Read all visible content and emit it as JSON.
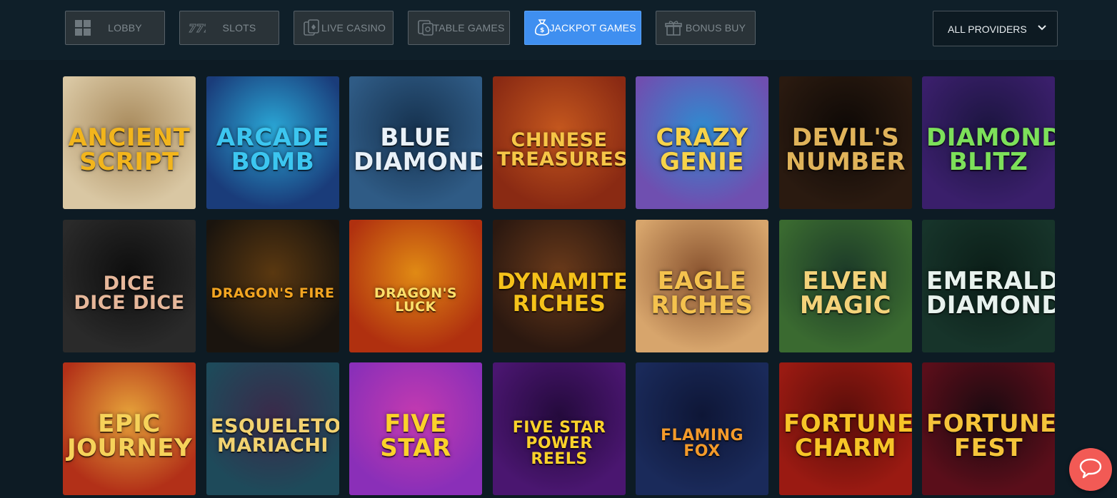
{
  "nav": {
    "tabs": [
      {
        "label": "LOBBY",
        "icon": "grid-icon"
      },
      {
        "label": "SLOTS",
        "icon": "slots-777-icon"
      },
      {
        "label": "LIVE CASINO",
        "icon": "live-casino-cards-icon"
      },
      {
        "label": "TABLE GAMES",
        "icon": "table-games-icon"
      },
      {
        "label": "JACKPOT GAMES",
        "icon": "money-bag-icon",
        "active": true
      },
      {
        "label": "BONUS BUY",
        "icon": "gift-icon"
      }
    ],
    "providers": {
      "label": "ALL PROVIDERS",
      "icon": "chevron-down-icon"
    }
  },
  "games": [
    {
      "name": "ANCIENT SCRIPT",
      "display": "ANCIENT\nSCRIPT",
      "bg": "#d9c7a3",
      "bg2": "#a88a5c",
      "fg": "#f2b51c"
    },
    {
      "name": "ARCADE BOMB",
      "display": "ARCADE\nBOMB",
      "bg": "#1a3c7a",
      "bg2": "#2aa7d6",
      "fg": "#3cc6f0"
    },
    {
      "name": "BLUE DIAMOND",
      "display": "BLUE\nDIAMOND",
      "bg": "#2f5b85",
      "bg2": "#16324f",
      "fg": "#e9f1f8"
    },
    {
      "name": "CHINESE TREASURES",
      "display": "CHINESE\nTREASURES",
      "bg": "#8a2a13",
      "bg2": "#c4571e",
      "fg": "#f6c647"
    },
    {
      "name": "CRAZY GENIE",
      "display": "CRAZY\nGENIE",
      "bg": "#6f4fb0",
      "bg2": "#2f8bd0",
      "fg": "#f7d34a"
    },
    {
      "name": "DEVIL'S NUMBER",
      "display": "DEVIL'S\nNUMBER",
      "bg": "#2a1a10",
      "bg2": "#0e0906",
      "fg": "#e0b35a"
    },
    {
      "name": "DIAMOND BLITZ",
      "display": "DIAMOND\nBLITZ",
      "bg": "#3a1f6b",
      "bg2": "#1c1540",
      "fg": "#7de05a"
    },
    {
      "name": "DICE DICE DICE",
      "display": "DICE\nDICE DICE",
      "bg": "#2a2a2a",
      "bg2": "#0e0e0e",
      "fg": "#e6b79a"
    },
    {
      "name": "DRAGON'S FIRE",
      "display": "DRAGON'S FIRE",
      "bg": "#1a140e",
      "bg2": "#5a3810",
      "fg": "#f3a521"
    },
    {
      "name": "DRAGON'S LUCK",
      "display": "DRAGON'S LUCK",
      "bg": "#b0300f",
      "bg2": "#e08a14",
      "fg": "#fce06a"
    },
    {
      "name": "DYNAMITE RICHES",
      "display": "DYNAMITE\nRICHES",
      "bg": "#2b1810",
      "bg2": "#6a3a1a",
      "fg": "#f5c21a"
    },
    {
      "name": "EAGLE RICHES",
      "display": "EAGLE\nRICHES",
      "bg": "#d7a56c",
      "bg2": "#8a5430",
      "fg": "#f4c24e"
    },
    {
      "name": "ELVEN MAGIC",
      "display": "ELVEN\nMAGIC",
      "bg": "#3a6a30",
      "bg2": "#1c3a28",
      "fg": "#f3d27a"
    },
    {
      "name": "EMERALD DIAMOND",
      "display": "EMERALD\nDIAMOND",
      "bg": "#17342a",
      "bg2": "#0b1e18",
      "fg": "#e8f2ee"
    },
    {
      "name": "EPIC JOURNEY",
      "display": "EPIC\nJOURNEY",
      "bg": "#b23018",
      "bg2": "#e6a33a",
      "fg": "#f6d25a"
    },
    {
      "name": "ESQUELETO MARIACHI",
      "display": "ESQUELETO\nMARIACHI",
      "bg": "#1e4a5a",
      "bg2": "#3a2a4a",
      "fg": "#f2d270"
    },
    {
      "name": "FIVE STAR",
      "display": "FIVE\nSTAR",
      "bg": "#8a2fb8",
      "bg2": "#c43ab0",
      "fg": "#fbd22a"
    },
    {
      "name": "FIVE STAR POWER REELS",
      "display": "FIVE STAR\nPOWER REELS",
      "bg": "#4a1670",
      "bg2": "#240a3c",
      "fg": "#fbd22a"
    },
    {
      "name": "FLAMING FOX",
      "display": "FLAMING FOX",
      "bg": "#1a2a5a",
      "bg2": "#0e1636",
      "fg": "#f39a2a"
    },
    {
      "name": "FORTUNE CHARM",
      "display": "FORTUNE\nCHARM",
      "bg": "#9a1a12",
      "bg2": "#5a0e0a",
      "fg": "#f7c527"
    },
    {
      "name": "FORTUNE FEST",
      "display": "FORTUNE\nFEST",
      "bg": "#5a0e1a",
      "bg2": "#1a0a10",
      "fg": "#f5c43a"
    }
  ],
  "chat": {
    "icon": "chat-bubble-icon"
  }
}
